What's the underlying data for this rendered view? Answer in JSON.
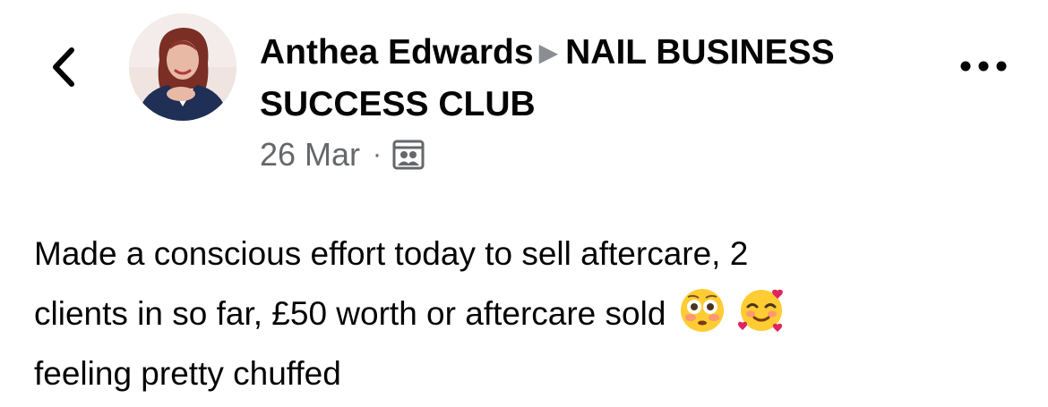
{
  "header": {
    "author_name": "Anthea Edwards",
    "group_name": "NAIL BUSINESS SUCCESS CLUB",
    "separator_icon": "triangle-right-icon",
    "date": "26 Mar",
    "meta_separator": "·",
    "audience_icon": "group-audience-icon"
  },
  "toolbar": {
    "back_icon": "chevron-left-icon",
    "more_icon": "more-horizontal-icon"
  },
  "post": {
    "text_line_1": "Made a conscious effort today to sell aftercare, 2",
    "text_line_2": "clients in so far, £50 worth or aftercare sold",
    "text_line_3": "feeling pretty chuffed",
    "emojis": [
      "flushed-face",
      "smiling-face-with-hearts"
    ]
  },
  "colors": {
    "text": "#050505",
    "secondary_text": "#65676b",
    "separator_arrow": "#8a8d91",
    "background": "#ffffff"
  }
}
